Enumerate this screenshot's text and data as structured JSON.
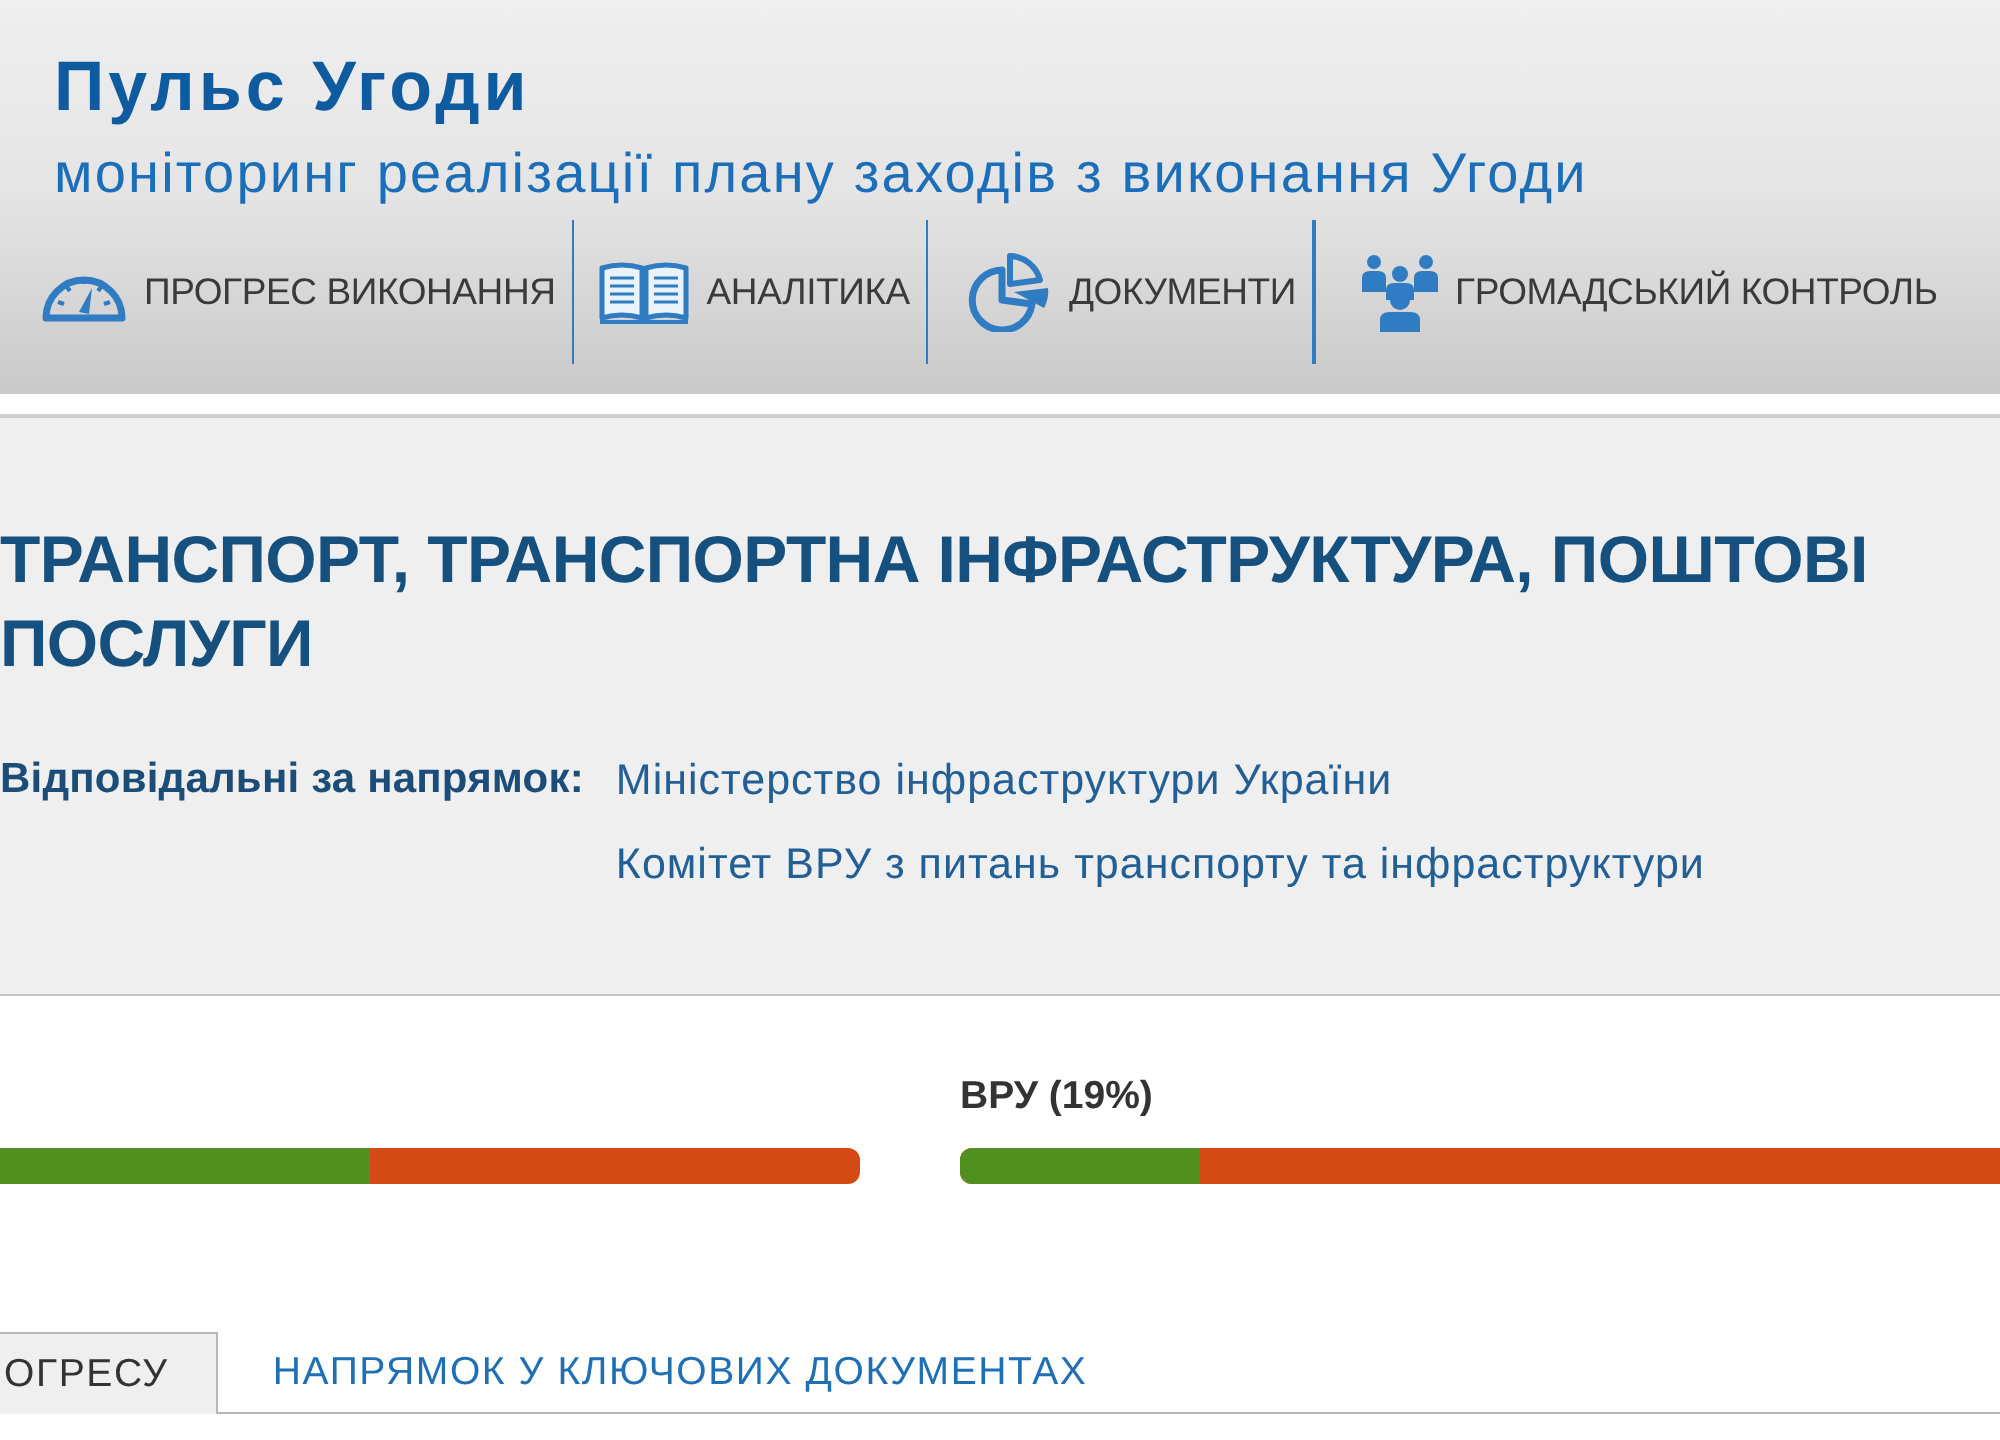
{
  "header": {
    "title": "Пульс Угоди",
    "subtitle": "моніторинг реалізації плану заходів з виконання Угоди"
  },
  "nav": [
    {
      "label": "ПРОГРЕС ВИКОНАННЯ"
    },
    {
      "label": "АНАЛІТИКА"
    },
    {
      "label": "ДОКУМЕНТИ"
    },
    {
      "label": "ГРОМАДСЬКИЙ КОНТРОЛЬ"
    }
  ],
  "direction": {
    "title": "ТРАНСПОРТ, ТРАНСПОРТНА ІНФРАСТРУКТУРА, ПОШТОВІ ПОСЛУГИ",
    "responsible_label": "Відповідальні за напрямок:",
    "responsible": [
      "Міністерство інфраструктури України",
      "Комітет ВРУ з питань транспорту та інфраструктури"
    ]
  },
  "progress": [
    {
      "level": 0.43
    },
    {
      "label": "ВРУ (19%)",
      "level": 0.23
    }
  ],
  "tabs": [
    {
      "label": "ОГРЕСУ",
      "selected": true
    },
    {
      "label": "НАПРЯМОК У КЛЮЧОВИХ ДОКУМЕНТАХ",
      "selected": false
    }
  ]
}
